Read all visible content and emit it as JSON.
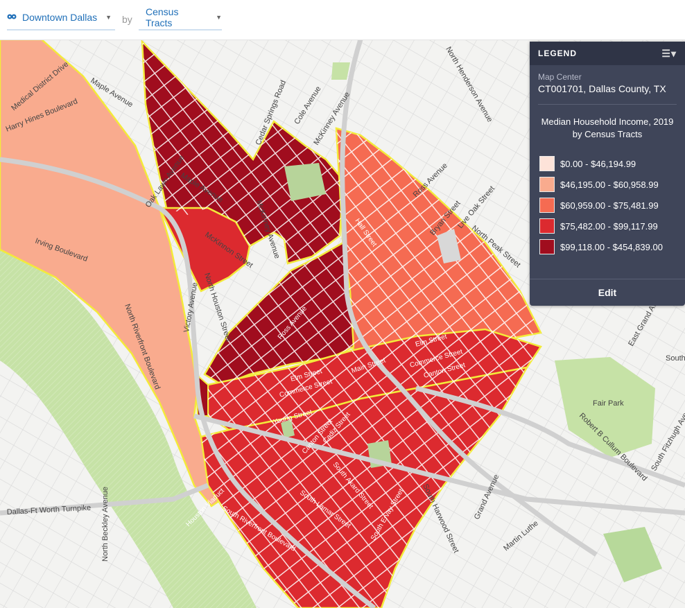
{
  "toolbar": {
    "location_label": "Downtown Dallas",
    "by_label": "by",
    "geography_label": "Census Tracts"
  },
  "legend": {
    "header": "LEGEND",
    "map_center_label": "Map Center",
    "map_center_value": "CT001701, Dallas County, TX",
    "title_line1": "Median Household Income, 2019",
    "title_line2": "by Census Tracts",
    "classes": [
      {
        "label": "$0.00 - $46,194.99",
        "color": "#fde3d9"
      },
      {
        "label": "$46,195.00 - $60,958.99",
        "color": "#f9ab8e"
      },
      {
        "label": "$60,959.00 - $75,481.99",
        "color": "#f56b52"
      },
      {
        "label": "$75,482.00 - $99,117.99",
        "color": "#dc2a2f"
      },
      {
        "label": "$99,118.00 - $454,839.00",
        "color": "#a00d1e"
      }
    ],
    "edit_label": "Edit"
  },
  "colors": {
    "accent": "#1f6fb8",
    "tract_border": "#f3ea3a",
    "park": "#c6e2a6",
    "water_park": "#bcdb95",
    "road": "#ffffff"
  },
  "map_labels": {
    "n_henderson": "North Henderson Avenue",
    "cole": "Cole Avenue",
    "mckinney": "McKinney Avenue",
    "cedar_springs": "Cedar Springs Road",
    "harry_hines": "Harry Hines Boulevard",
    "medical_district": "Medical District Drive",
    "maple_ave": "Maple Avenue",
    "maple_ave2": "Maple Avenue",
    "oak_lawn": "Oak Lawn Avenue",
    "irving": "Irving Boulevard",
    "n_riverfront": "North Riverfront Boulevard",
    "victory": "Victory Avenue",
    "n_houston": "North Houston Street",
    "mckinnon": "McKinnon Street",
    "ross": "Ross Avenue",
    "ross2": "Ross Avenue",
    "hall": "Hall Street",
    "live_oak": "Live Oak Street",
    "bryan": "Bryan Street",
    "n_peak": "North Peak Street",
    "main_st": "Main Street",
    "elm_st": "Elm Street",
    "elm_st2": "Elm Street",
    "commerce": "Commerce Street",
    "commerce2": "Commerce Street",
    "canton": "Canton Street",
    "canton2": "Canton Street",
    "young": "Young Street",
    "cadiz": "Cadiz Street",
    "s_lamar": "South Lamar Street",
    "s_akard": "South Akard Street",
    "s_ervay": "South Ervay Street",
    "s_harwood": "South Harwood Street",
    "grand": "Grand Avenue",
    "martin_luther": "Martin Luthe",
    "robert_cullum": "Robert B Cullum Boulevard",
    "s_fitzhugh": "South Fitzhugh Ave",
    "east_grand": "East Grand Ave",
    "fair_park": "Fair Park",
    "south": "South",
    "dallas_fw": "Dallas-Ft Worth Turnpike",
    "n_beckley": "North Beckley Avenue",
    "houston_viaduct": "Houston Viaduct",
    "s_riverfront": "South Riverfront Boulevard",
    "main_st2": "Main Street",
    "s_pearl": "S Pearl Expy"
  }
}
